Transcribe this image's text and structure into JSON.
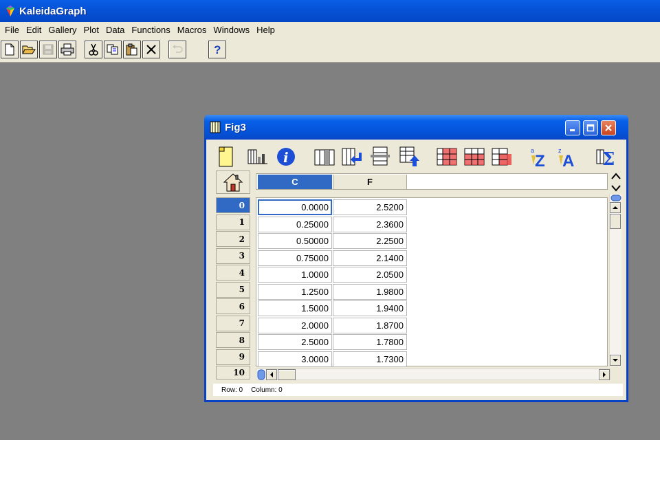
{
  "app": {
    "title": "KaleidaGraph"
  },
  "menu": [
    "File",
    "Edit",
    "Gallery",
    "Plot",
    "Data",
    "Functions",
    "Macros",
    "Windows",
    "Help"
  ],
  "toolbar": {
    "buttons": [
      "new-doc",
      "open-folder",
      "save",
      "print",
      "cut",
      "copy",
      "paste",
      "delete",
      "undo",
      "help"
    ]
  },
  "window": {
    "title": "Fig3",
    "columns": [
      "C",
      "F"
    ],
    "rows": [
      {
        "index": "0",
        "c": "0.0000",
        "f": "2.5200"
      },
      {
        "index": "1",
        "c": "0.25000",
        "f": "2.3600"
      },
      {
        "index": "2",
        "c": "0.50000",
        "f": "2.2500"
      },
      {
        "index": "3",
        "c": "0.75000",
        "f": "2.1400"
      },
      {
        "index": "4",
        "c": "1.0000",
        "f": "2.0500"
      },
      {
        "index": "5",
        "c": "1.2500",
        "f": "1.9800"
      },
      {
        "index": "6",
        "c": "1.5000",
        "f": "1.9400"
      },
      {
        "index": "7",
        "c": "2.0000",
        "f": "1.8700"
      },
      {
        "index": "8",
        "c": "2.5000",
        "f": "1.7800"
      },
      {
        "index": "9",
        "c": "3.0000",
        "f": "1.7300"
      }
    ],
    "next_row_index": "10",
    "status": {
      "row": "Row: 0",
      "column": "Column: 0"
    }
  },
  "colors": {
    "selection": "#316ac5",
    "titlebar": "#0653d7",
    "workspace": "#808080"
  }
}
